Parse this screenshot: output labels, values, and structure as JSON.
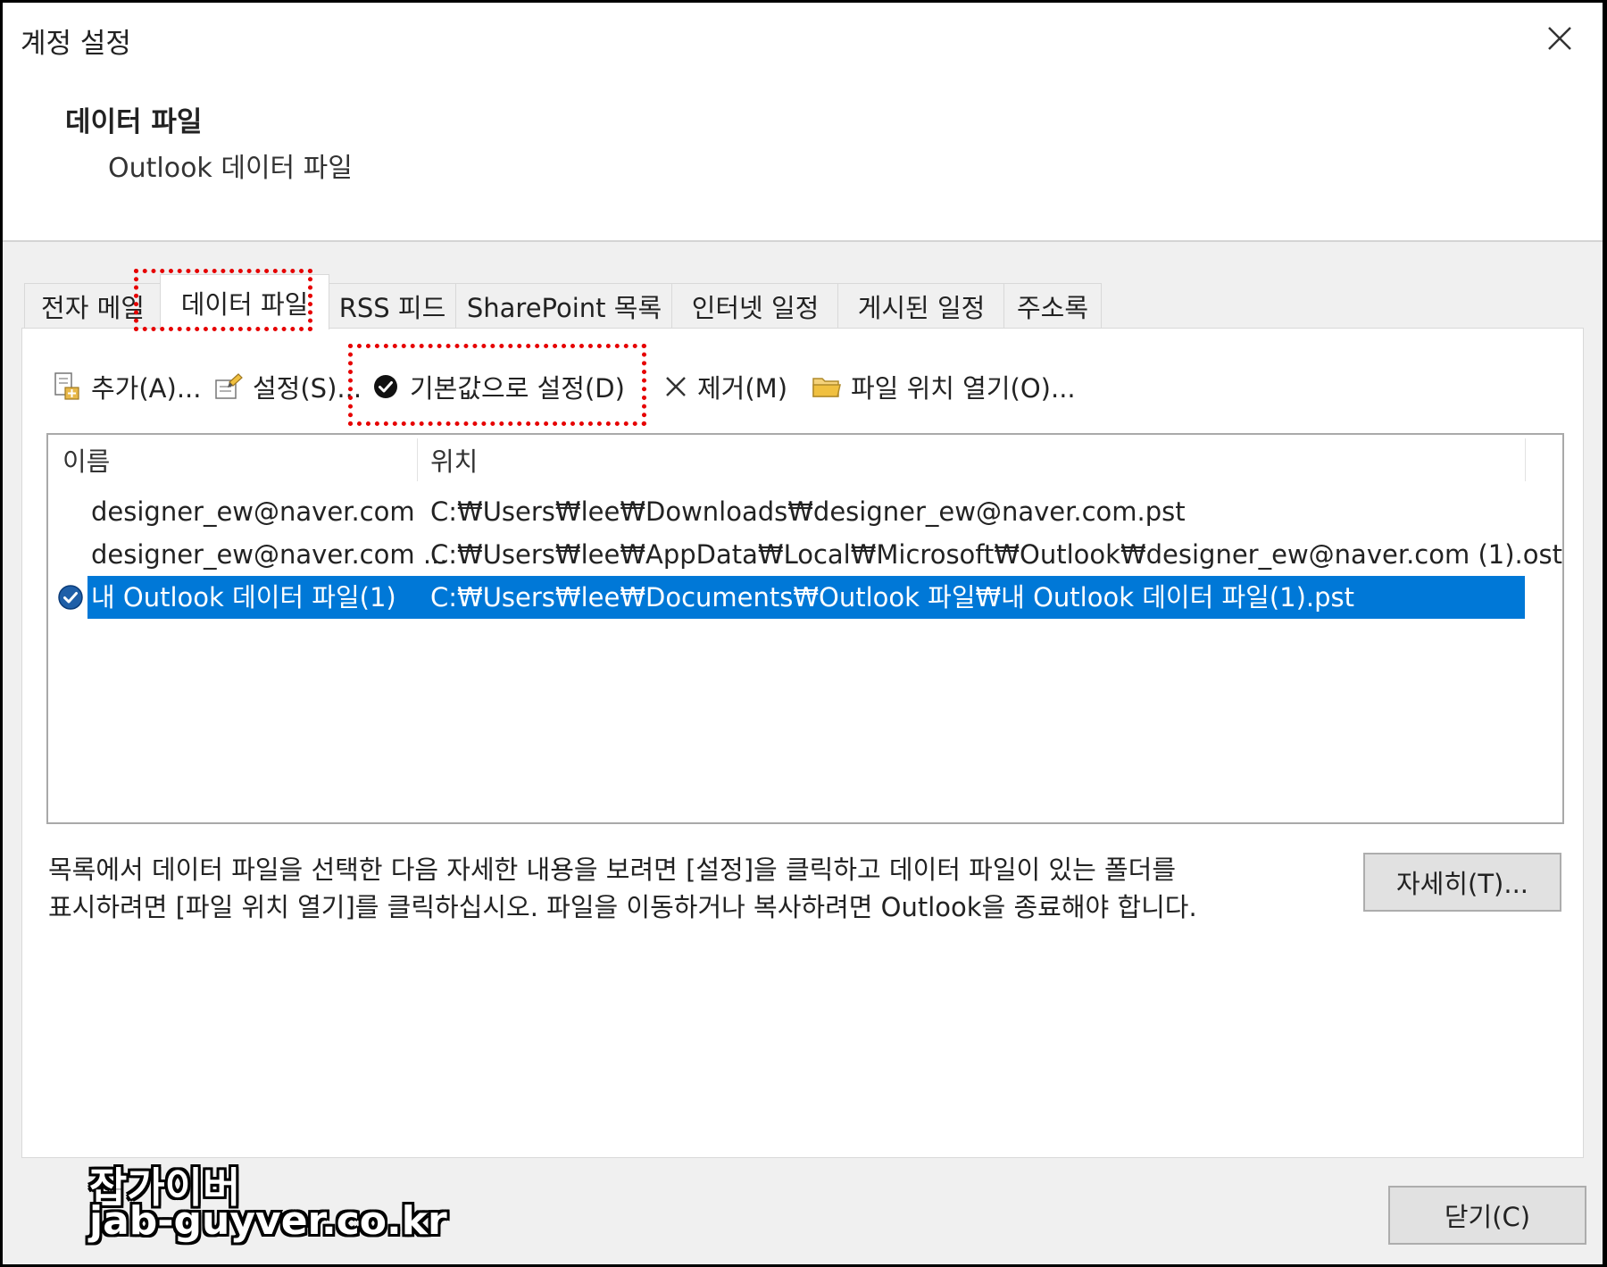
{
  "window": {
    "title": "계정 설정"
  },
  "header": {
    "title": "데이터 파일",
    "subtitle": "Outlook 데이터 파일"
  },
  "tabs": [
    {
      "label": "전자 메일"
    },
    {
      "label": "데이터 파일",
      "active": true
    },
    {
      "label": "RSS 피드"
    },
    {
      "label": "SharePoint 목록"
    },
    {
      "label": "인터넷 일정"
    },
    {
      "label": "게시된 일정"
    },
    {
      "label": "주소록"
    }
  ],
  "toolbar": {
    "add_label": "추가(A)...",
    "settings_label": "설정(S)...",
    "set_default_label": "기본값으로 설정(D)",
    "remove_label": "제거(M)",
    "open_location_label": "파일 위치 열기(O)..."
  },
  "table": {
    "columns": [
      "이름",
      "위치"
    ],
    "rows": [
      {
        "name": "designer_ew@naver.com",
        "location": "C:₩Users₩lee₩Downloads₩designer_ew@naver.com.pst",
        "default": false,
        "selected": false
      },
      {
        "name": "designer_ew@naver.com ...",
        "location": "C:₩Users₩lee₩AppData₩Local₩Microsoft₩Outlook₩designer_ew@naver.com (1).ost",
        "default": false,
        "selected": false
      },
      {
        "name": "내 Outlook 데이터 파일(1)",
        "location": "C:₩Users₩lee₩Documents₩Outlook 파일₩내 Outlook 데이터 파일(1).pst",
        "default": true,
        "selected": true
      }
    ]
  },
  "description": {
    "line1": "목록에서 데이터 파일을 선택한 다음 자세한 내용을 보려면 [설정]을 클릭하고 데이터 파일이 있는 폴더를",
    "line2": "표시하려면 [파일 위치 열기]를 클릭하십시오. 파일을 이동하거나 복사하려면 Outlook을 종료해야 합니다."
  },
  "buttons": {
    "details_label": "자세히(T)...",
    "close_label": "닫기(C)"
  },
  "watermark": {
    "line1": "잡가이버",
    "line2": "jab-guyver.co.kr"
  },
  "colors": {
    "selection": "#0078d7",
    "highlight": "#e60000",
    "button_face": "#e1e1e1"
  },
  "icons": {
    "close": "close-icon",
    "add": "add-file-icon",
    "settings": "settings-file-icon",
    "set_default": "check-circle-icon",
    "remove": "x-icon",
    "open_location": "folder-icon",
    "row_default": "default-check-icon"
  }
}
